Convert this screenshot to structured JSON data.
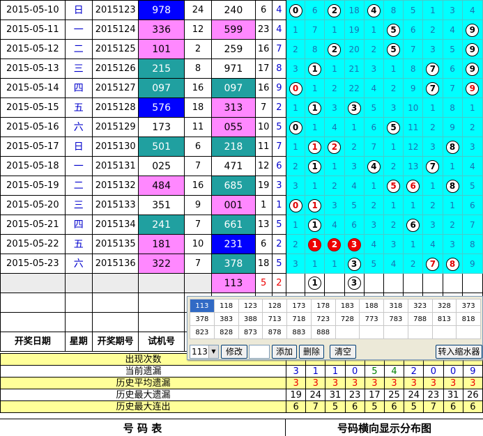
{
  "rows": [
    {
      "date": "2015-05-10",
      "week": "日",
      "issue": "2015123",
      "test": "978",
      "sum": "24",
      "draw": "240",
      "span": "6",
      "span2": "4",
      "dist": [
        "0",
        "6",
        "2",
        "18",
        "4",
        "8",
        "5",
        "1",
        "3",
        "4"
      ]
    },
    {
      "date": "2015-05-11",
      "week": "一",
      "issue": "2015124",
      "test": "336",
      "sum": "12",
      "draw": "599",
      "span": "23",
      "span2": "4",
      "dist": [
        "1",
        "7",
        "1",
        "19",
        "1",
        "5",
        "6",
        "2",
        "4",
        "9"
      ]
    },
    {
      "date": "2015-05-12",
      "week": "二",
      "issue": "2015125",
      "test": "101",
      "sum": "2",
      "draw": "259",
      "span": "16",
      "span2": "7",
      "dist": [
        "2",
        "8",
        "2",
        "20",
        "2",
        "5",
        "7",
        "3",
        "5",
        "9"
      ]
    },
    {
      "date": "2015-05-13",
      "week": "三",
      "issue": "2015126",
      "test": "215",
      "sum": "8",
      "draw": "971",
      "span": "17",
      "span2": "8",
      "dist": [
        "3",
        "1",
        "1",
        "21",
        "3",
        "1",
        "8",
        "7",
        "6",
        "9"
      ]
    },
    {
      "date": "2015-05-14",
      "week": "四",
      "issue": "2015127",
      "test": "097",
      "sum": "16",
      "draw": "097",
      "span": "16",
      "span2": "9",
      "dist": [
        "0",
        "1",
        "2",
        "22",
        "4",
        "2",
        "9",
        "7",
        "7",
        "9"
      ]
    },
    {
      "date": "2015-05-15",
      "week": "五",
      "issue": "2015128",
      "test": "576",
      "sum": "18",
      "draw": "313",
      "span": "7",
      "span2": "2",
      "dist": [
        "1",
        "1",
        "3",
        "3",
        "5",
        "3",
        "10",
        "1",
        "8",
        "1"
      ]
    },
    {
      "date": "2015-05-16",
      "week": "六",
      "issue": "2015129",
      "test": "173",
      "sum": "11",
      "draw": "055",
      "span": "10",
      "span2": "5",
      "dist": [
        "0",
        "1",
        "4",
        "1",
        "6",
        "5",
        "11",
        "2",
        "9",
        "2"
      ]
    },
    {
      "date": "2015-05-17",
      "week": "日",
      "issue": "2015130",
      "test": "501",
      "sum": "6",
      "draw": "218",
      "span": "11",
      "span2": "7",
      "dist": [
        "1",
        "1",
        "2",
        "2",
        "7",
        "1",
        "12",
        "3",
        "8",
        "3"
      ]
    },
    {
      "date": "2015-05-18",
      "week": "一",
      "issue": "2015131",
      "test": "025",
      "sum": "7",
      "draw": "471",
      "span": "12",
      "span2": "6",
      "dist": [
        "2",
        "1",
        "1",
        "3",
        "4",
        "2",
        "13",
        "7",
        "1",
        "4"
      ]
    },
    {
      "date": "2015-05-19",
      "week": "二",
      "issue": "2015132",
      "test": "484",
      "sum": "16",
      "draw": "685",
      "span": "19",
      "span2": "3",
      "dist": [
        "3",
        "1",
        "2",
        "4",
        "1",
        "5",
        "6",
        "1",
        "8",
        "5"
      ]
    },
    {
      "date": "2015-05-20",
      "week": "三",
      "issue": "2015133",
      "test": "351",
      "sum": "9",
      "draw": "001",
      "span": "1",
      "span2": "1",
      "dist": [
        "0",
        "1",
        "3",
        "5",
        "2",
        "1",
        "1",
        "2",
        "1",
        "6"
      ]
    },
    {
      "date": "2015-05-21",
      "week": "四",
      "issue": "2015134",
      "test": "241",
      "sum": "7",
      "draw": "661",
      "span": "13",
      "span2": "5",
      "dist": [
        "1",
        "1",
        "4",
        "6",
        "3",
        "2",
        "6",
        "3",
        "2",
        "7"
      ]
    },
    {
      "date": "2015-05-22",
      "week": "五",
      "issue": "2015135",
      "test": "181",
      "sum": "10",
      "draw": "231",
      "span": "6",
      "span2": "2",
      "dist": [
        "2",
        "1",
        "2",
        "3",
        "4",
        "3",
        "1",
        "4",
        "3",
        "8"
      ]
    },
    {
      "date": "2015-05-23",
      "week": "六",
      "issue": "2015136",
      "test": "322",
      "sum": "7",
      "draw": "378",
      "span": "18",
      "span2": "5",
      "dist": [
        "3",
        "1",
        "1",
        "3",
        "5",
        "4",
        "2",
        "7",
        "8",
        "9"
      ]
    }
  ],
  "balls": [
    [
      [
        0,
        "n"
      ],
      [
        2,
        "n"
      ],
      [
        4,
        "n"
      ]
    ],
    [
      [
        5,
        "n"
      ],
      [
        9,
        "n"
      ]
    ],
    [
      [
        2,
        "n"
      ],
      [
        5,
        "n"
      ],
      [
        9,
        "n"
      ]
    ],
    [
      [
        1,
        "n"
      ],
      [
        7,
        "n"
      ],
      [
        9,
        "n"
      ]
    ],
    [
      [
        0,
        "r"
      ],
      [
        7,
        "n"
      ],
      [
        9,
        "r"
      ]
    ],
    [
      [
        1,
        "n"
      ],
      [
        3,
        "n"
      ]
    ],
    [
      [
        0,
        "n"
      ],
      [
        5,
        "n"
      ]
    ],
    [
      [
        1,
        "r"
      ],
      [
        2,
        "r"
      ],
      [
        8,
        "n"
      ]
    ],
    [
      [
        1,
        "n"
      ],
      [
        4,
        "n"
      ],
      [
        7,
        "n"
      ]
    ],
    [
      [
        5,
        "r"
      ],
      [
        6,
        "r"
      ],
      [
        8,
        "n"
      ]
    ],
    [
      [
        0,
        "r"
      ],
      [
        1,
        "r"
      ]
    ],
    [
      [
        1,
        "n"
      ],
      [
        6,
        "n"
      ]
    ],
    [
      [
        1,
        "s"
      ],
      [
        2,
        "s"
      ],
      [
        3,
        "s"
      ]
    ],
    [
      [
        3,
        "n"
      ],
      [
        7,
        "r"
      ],
      [
        8,
        "r"
      ]
    ]
  ],
  "pending_row": {
    "draw": "113",
    "span": "5",
    "span2": "2",
    "balls": [
      1,
      3
    ]
  },
  "headers": {
    "date": "开奖日期",
    "week": "星期",
    "issue": "开奖期号",
    "test": "试机号"
  },
  "popup": {
    "combos": [
      [
        "113",
        "118",
        "123",
        "128",
        "173",
        "178",
        "183",
        "188",
        "318",
        "323",
        "328",
        "373"
      ],
      [
        "378",
        "383",
        "388",
        "713",
        "718",
        "723",
        "728",
        "773",
        "783",
        "788",
        "813",
        "818"
      ],
      [
        "823",
        "828",
        "873",
        "878",
        "883",
        "888",
        "",
        "",
        "",
        "",
        "",
        ""
      ]
    ],
    "select_value": "113",
    "buttons": {
      "modify": "修改",
      "add": "添加",
      "delete": "删除",
      "clear": "清空",
      "shrink": "转入缩水器"
    }
  },
  "stats": [
    {
      "label": "出现次数",
      "color": "#ffff99",
      "values": [
        "",
        "",
        "",
        "",
        "",
        "",
        "",
        "",
        "",
        ""
      ]
    },
    {
      "label": "当前遗漏",
      "color": "#ffffff",
      "values": [
        "3",
        "1",
        "1",
        "0",
        "5",
        "4",
        "2",
        "0",
        "0",
        "9"
      ]
    },
    {
      "label": "历史平均遗漏",
      "color": "#ffff99",
      "values": [
        "3",
        "3",
        "3",
        "3",
        "3",
        "3",
        "3",
        "3",
        "3",
        "3"
      ]
    },
    {
      "label": "历史最大遗漏",
      "color": "#ffffff",
      "values": [
        "19",
        "24",
        "31",
        "23",
        "17",
        "25",
        "24",
        "23",
        "31",
        "26"
      ]
    },
    {
      "label": "历史最大连出",
      "color": "#ffff99",
      "values": [
        "6",
        "7",
        "5",
        "6",
        "5",
        "6",
        "5",
        "7",
        "6",
        "6"
      ]
    }
  ],
  "footer": {
    "left": "号 码 表",
    "right": "号码横向显示分布图"
  }
}
